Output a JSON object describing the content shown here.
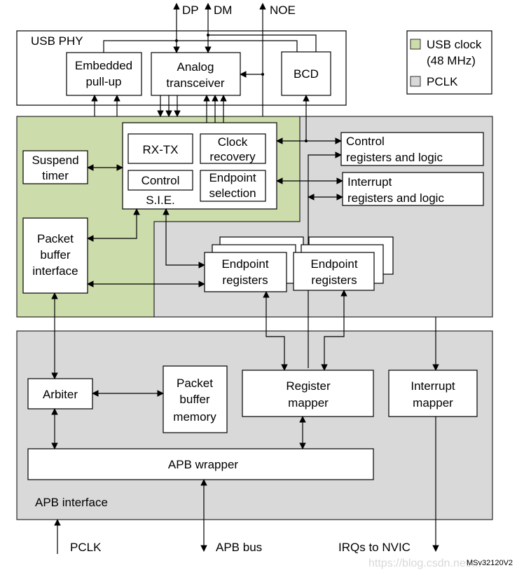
{
  "colors": {
    "usb_clock": "#ccdcaa",
    "pclk": "#d9d9d9"
  },
  "signals": {
    "dp": "DP",
    "dm": "DM",
    "noe": "NOE",
    "pclk": "PCLK",
    "apb_bus": "APB bus",
    "irqs": "IRQs to NVIC"
  },
  "legend": {
    "usb_clock_line1": "USB clock",
    "usb_clock_line2": "(48 MHz)",
    "pclk": "PCLK"
  },
  "usb_phy": {
    "title": "USB PHY",
    "embedded_pullup": [
      "Embedded",
      "pull-up"
    ],
    "analog_transceiver": [
      "Analog",
      "transceiver"
    ],
    "bcd": "BCD"
  },
  "sie": {
    "label": "S.I.E.",
    "rx_tx": "RX-TX",
    "clock_recovery": [
      "Clock",
      "recovery"
    ],
    "control": "Control",
    "endpoint_selection": [
      "Endpoint",
      "selection"
    ]
  },
  "blocks": {
    "suspend_timer": [
      "Suspend",
      "timer"
    ],
    "packet_buffer_interface": [
      "Packet",
      "buffer",
      "interface"
    ],
    "control_registers": [
      "Control",
      "registers and logic"
    ],
    "interrupt_registers": [
      "Interrupt",
      "registers and logic"
    ],
    "endpoint_registers": [
      "Endpoint",
      "registers"
    ],
    "arbiter": "Arbiter",
    "packet_buffer_memory": [
      "Packet",
      "buffer",
      "memory"
    ],
    "register_mapper": [
      "Register",
      "mapper"
    ],
    "interrupt_mapper": [
      "Interrupt",
      "mapper"
    ],
    "apb_wrapper": "APB wrapper",
    "apb_interface": "APB interface"
  },
  "figure_id": "MSv32120V2",
  "watermark": "https://blog.csdn.net/..."
}
